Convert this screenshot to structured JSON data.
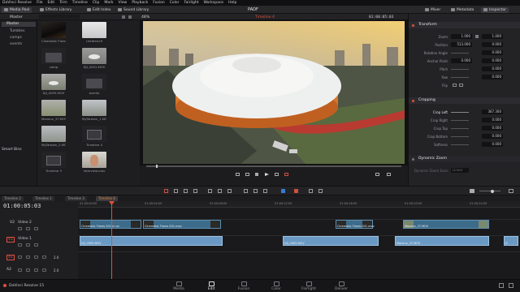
{
  "menu": [
    "DaVinci Resolve",
    "File",
    "Edit",
    "Trim",
    "Timeline",
    "Clip",
    "Mark",
    "View",
    "Playback",
    "Fusion",
    "Color",
    "Fairlight",
    "Workspace",
    "Help"
  ],
  "toolbar": {
    "media_pool": "Media Pool",
    "effects_library": "Effects Library",
    "edit_index": "Edit Index",
    "sound_library": "Sound Library",
    "project_title": "PADF",
    "mixer": "Mixer",
    "metadata": "Metadata",
    "inspector": "Inspector"
  },
  "media_pool": {
    "header": "Master",
    "bins": [
      "Master",
      "Tumbles",
      "comps",
      "events"
    ],
    "smart_bins": "Smart Bins",
    "clips": [
      {
        "name": "Cinematic Flares 001.mov"
      },
      {
        "name": "Untitled.tif"
      },
      {
        "name": "comp"
      },
      {
        "name": "DJI_0001.MOV"
      },
      {
        "name": "DJI_0005.MOV"
      },
      {
        "name": "events"
      },
      {
        "name": "Maneuv_37.MOV"
      },
      {
        "name": "MyStream_1.MOV"
      },
      {
        "name": "MyStream_2.MOV"
      },
      {
        "name": "Timeline 4"
      },
      {
        "name": "Timeline 3"
      },
      {
        "name": "Interview.mov"
      }
    ]
  },
  "viewer": {
    "zoom": "48%",
    "timeline_name": "Timeline 4",
    "timecode": "01:00:05:03",
    "clip_title": "Cinematic Flares 001.mov"
  },
  "inspector": {
    "transform_label": "Transform",
    "zoom_label": "Zoom",
    "zoom_x": "1.000",
    "zoom_y": "1.000",
    "position_label": "Position",
    "pos_x": "513.000",
    "pos_y": "0.000",
    "rotation_label": "Rotation Angle",
    "rotation": "0.000",
    "anchor_label": "Anchor Point",
    "anchor_x": "0.000",
    "anchor_y": "0.000",
    "pitch_label": "Pitch",
    "pitch": "0.000",
    "yaw_label": "Yaw",
    "yaw": "0.000",
    "flip_label": "Flip",
    "cropping_label": "Cropping",
    "crop_left_label": "Crop Left",
    "crop_left": "367.300",
    "crop_right_label": "Crop Right",
    "crop_right": "0.000",
    "crop_top_label": "Crop Top",
    "crop_top": "0.000",
    "crop_bottom_label": "Crop Bottom",
    "crop_bottom": "0.000",
    "softness_label": "Softness",
    "softness": "0.000",
    "dynamic_zoom_label": "Dynamic Zoom",
    "dz_ease_label": "Dynamic Zoom Ease",
    "dz_ease": "Linear"
  },
  "timeline": {
    "tabs": [
      "Timeline 2",
      "Timeline 1",
      "Timeline 3",
      "Timeline 4"
    ],
    "timecode": "01:00:05:03",
    "ruler": [
      "01:00:00:00",
      "01:00:04:00",
      "01:00:08:00",
      "01:00:12:00",
      "01:00:16:00",
      "01:00:20:00",
      "01:00:24:00"
    ],
    "tracks": {
      "v2_label": "Video 2",
      "v2_id": "V2",
      "v1_label": "Video 1",
      "v1_id": "V1",
      "a1_id": "A1",
      "a2_id": "A2",
      "a1_level": "2.0",
      "a2_level": "2.0"
    },
    "v2_clips": [
      {
        "name": "Cinematic Flares 001.m ov"
      },
      {
        "name": "Cinematic Flares 001.mov"
      },
      {
        "name": "Cinematic Flares 001.mov"
      },
      {
        "name": "Maneuv_37.MOV"
      }
    ],
    "v1_clips": [
      {
        "name": "DJI_0005.MOV"
      },
      {
        "name": "DJI_0005.MOV"
      },
      {
        "name": "Maneuv_37.MOV"
      },
      {
        "name": "D"
      }
    ]
  },
  "footer": {
    "app_name": "DaVinci Resolve 15",
    "pages": [
      "Media",
      "Edit",
      "Fusion",
      "Color",
      "Fairlight",
      "Deliver"
    ],
    "active_page": "Edit"
  },
  "colors": {
    "accent": "#e0503a",
    "clip_video": "#3d6b8a",
    "clip_audio": "#6a9ac4",
    "playhead": "#e0503a"
  }
}
